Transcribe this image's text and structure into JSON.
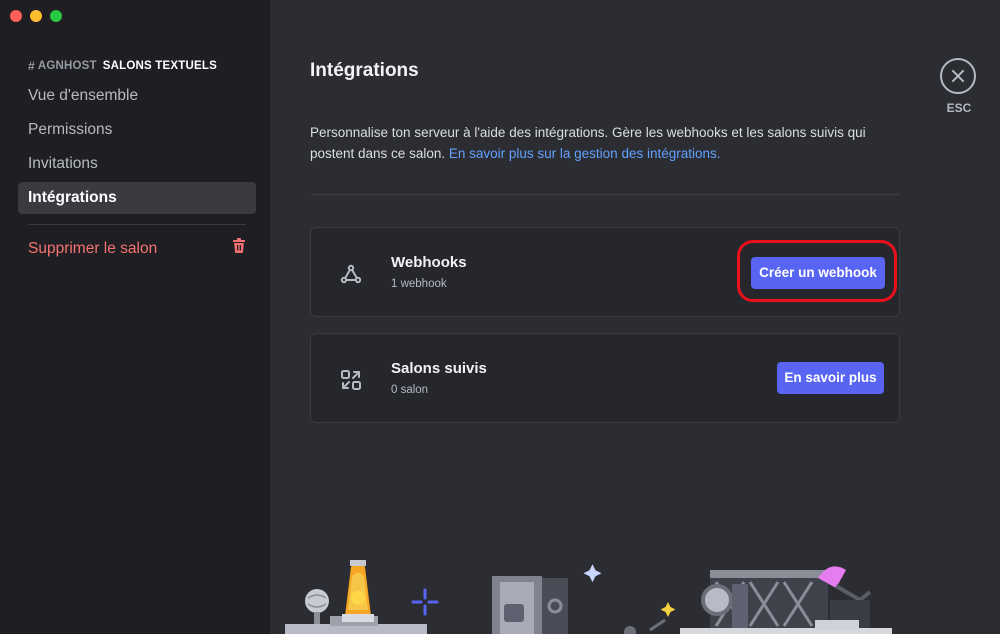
{
  "window": {
    "controls": [
      "close",
      "minimize",
      "zoom"
    ]
  },
  "sidebar": {
    "channel_hash": "#",
    "channel_name": "AGNHOST",
    "section_label": "SALONS TEXTUELS",
    "items": [
      {
        "label": "Vue d'ensemble",
        "active": false
      },
      {
        "label": "Permissions",
        "active": false
      },
      {
        "label": "Invitations",
        "active": false
      },
      {
        "label": "Intégrations",
        "active": true
      }
    ],
    "delete_label": "Supprimer le salon",
    "delete_icon": "trash-icon"
  },
  "main": {
    "title": "Intégrations",
    "description": "Personnalise ton serveur à l'aide des intégrations. Gère les webhooks et les salons suivis qui postent dans ce salon.",
    "link_text": "En savoir plus sur la gestion des intégrations.",
    "close_label": "ESC",
    "cards": [
      {
        "icon": "webhook-icon",
        "title": "Webhooks",
        "subtitle": "1 webhook",
        "button": "Créer un webhook",
        "highlighted": true
      },
      {
        "icon": "followed-channels-icon",
        "title": "Salons suivis",
        "subtitle": "0 salon",
        "button": "En savoir plus",
        "highlighted": false
      }
    ]
  },
  "colors": {
    "accent": "#5865f2",
    "link": "#62a0ff",
    "danger": "#f57272",
    "highlight_ring": "#e8111b",
    "sidebar_bg": "#1f1f23",
    "main_bg": "#2c2d32"
  }
}
